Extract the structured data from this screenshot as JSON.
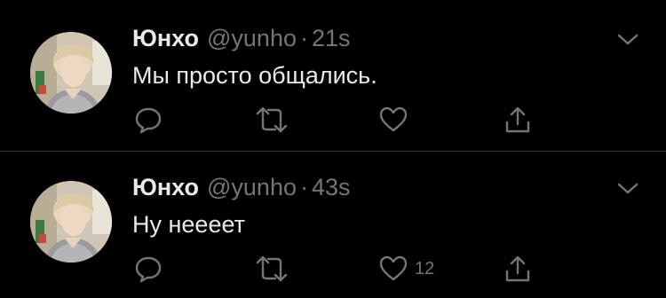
{
  "colors": {
    "background": "#000000",
    "primary_text": "#e7e9ea",
    "secondary_text": "#71767b",
    "divider": "#2f3336"
  },
  "tweets": [
    {
      "display_name": "Юнхо",
      "handle": "@yunho",
      "separator": "·",
      "time": "21s",
      "text": "Мы просто общались.",
      "actions": {
        "reply_icon": "reply-icon",
        "retweet_icon": "retweet-icon",
        "like_icon": "heart-icon",
        "like_count": "",
        "share_icon": "share-icon"
      }
    },
    {
      "display_name": "Юнхо",
      "handle": "@yunho",
      "separator": "·",
      "time": "43s",
      "text": "Ну неееет",
      "actions": {
        "reply_icon": "reply-icon",
        "retweet_icon": "retweet-icon",
        "like_icon": "heart-icon",
        "like_count": "12",
        "share_icon": "share-icon"
      }
    }
  ]
}
